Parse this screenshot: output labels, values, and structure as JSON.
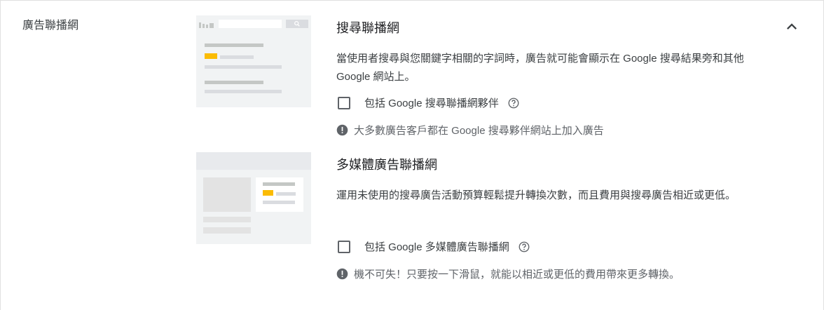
{
  "section": {
    "title": "廣告聯播網"
  },
  "collapse_icon": "chevron-up-icon",
  "search_network": {
    "title": "搜尋聯播網",
    "description": "當使用者搜尋與您關鍵字相關的字詞時，廣告就可能會顯示在 Google 搜尋結果旁和其他 Google 網站上。",
    "checkbox_label": "包括 Google 搜尋聯播網夥伴",
    "checked": false,
    "help_icon": "help-circle-icon",
    "note_icon": "info-exclamation-icon",
    "note": "大多數廣告客戶都在 Google 搜尋夥伴網站上加入廣告"
  },
  "display_network": {
    "title": "多媒體廣告聯播網",
    "description": "運用未使用的搜尋廣告活動預算輕鬆提升轉換次數，而且費用與搜尋廣告相近或更低。",
    "checkbox_label": "包括 Google 多媒體廣告聯播網",
    "checked": false,
    "help_icon": "help-circle-icon",
    "note_icon": "info-exclamation-icon",
    "note": "機不可失！只要按一下滑鼠，就能以相近或更低的費用帶來更多轉換。"
  },
  "colors": {
    "accent_yellow": "#fbbc04",
    "illustration_bg": "#f1f3f4",
    "bar_gray": "#dadce0"
  }
}
